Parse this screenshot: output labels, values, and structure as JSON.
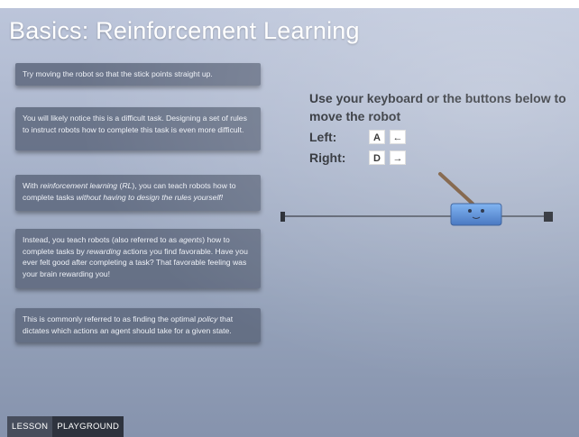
{
  "page": {
    "title": "Basics: Reinforcement Learning"
  },
  "cards": {
    "c1": {
      "text": "Try moving the robot so that the stick points straight up."
    },
    "c2": {
      "text": "You will likely notice this is a difficult task. Designing a set of rules to instruct robots how to complete this task is even more difficult."
    },
    "c3": {
      "p1": "With ",
      "em1": "reinforcement learning",
      "p2": " (",
      "em2": "RL",
      "p3": "), you can teach robots how to complete tasks ",
      "em3": "without having to design the rules yourself!"
    },
    "c4": {
      "p1": "Instead, you teach robots (also referred to as ",
      "em1": "agents",
      "p2": ") how to complete tasks by ",
      "em2": "rewarding",
      "p3": " actions you find favorable. Have you ever felt good after completing a task? That favorable feeling was your brain rewarding you!"
    },
    "c5": {
      "p1": "This is commonly referred to as finding the optimal ",
      "em1": "policy",
      "p2": " that dictates which actions an agent should take for a given state."
    }
  },
  "controls": {
    "instruction_line1": "Use your keyboard or the buttons below to",
    "instruction_line2": "move the robot",
    "left_label": "Left:",
    "left_key": "A",
    "left_arrow": "←",
    "right_label": "Right:",
    "right_key": "D",
    "right_arrow": "→"
  },
  "tabs": {
    "lesson": "LESSON",
    "playground": "PLAYGROUND"
  },
  "colors": {
    "robot": "#3f7fd6",
    "stick": "#7a5634",
    "rail": "#2b2f38"
  }
}
